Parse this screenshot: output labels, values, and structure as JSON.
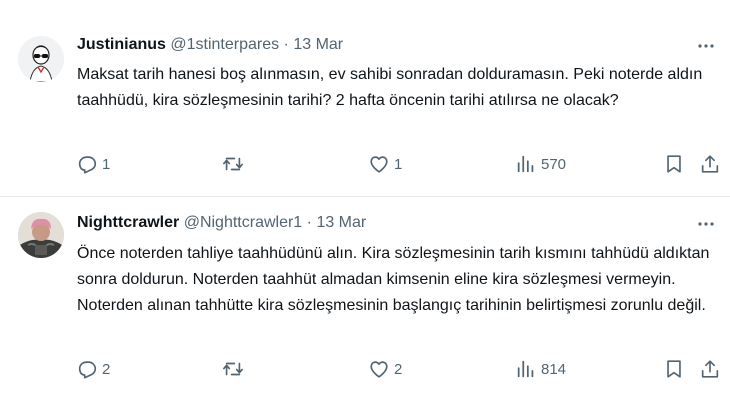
{
  "tweets": [
    {
      "display_name": "Justinianus",
      "handle": "@1stinterpares",
      "separator": "·",
      "date": "13 Mar",
      "text": "Maksat tarih hanesi boş alınmasın, ev sahibi sonradan dolduramasın. Peki noterde aldın taahhüdü, kira sözleşmesinin tarihi? 2 hafta öncenin tarihi atılırsa ne olacak?",
      "replies": "1",
      "retweets": "",
      "likes": "1",
      "views": "570"
    },
    {
      "display_name": "Nighttcrawler",
      "handle": "@Nighttcrawler1",
      "separator": "·",
      "date": "13 Mar",
      "text": "Önce noterden tahliye taahhüdünü alın. Kira sözleşmesinin tarih kısmını tahhüdü aldıktan sonra doldurun. Noterden taahhüt almadan kimsenin eline kira sözleşmesi vermeyin. Noterden alınan tahhütte kira sözleşmesinin başlangıç tarihinin belirtişmesi zorunlu değil.",
      "replies": "2",
      "retweets": "",
      "likes": "2",
      "views": "814"
    }
  ],
  "icons": {
    "reply": "reply-icon",
    "retweet": "retweet-icon",
    "like": "heart-icon",
    "views": "views-icon",
    "bookmark": "bookmark-icon",
    "share": "share-icon",
    "more": "more-icon"
  },
  "colors": {
    "text": "#0f1419",
    "secondary": "#536471",
    "divider": "#e6e9ea"
  }
}
